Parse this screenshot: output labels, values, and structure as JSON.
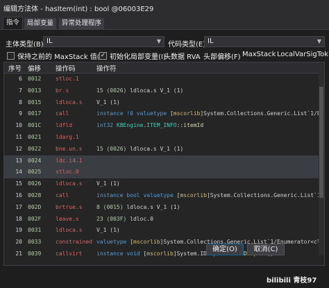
{
  "window": {
    "title": "编辑方法体 - hasItem(int) : bool @06003E29"
  },
  "tabs": [
    "指令",
    "局部变量",
    "异常处理程序"
  ],
  "header": {
    "body_type_label": "主体类型(B)",
    "body_type_value": "IL",
    "code_type_label": "代码类型(E)",
    "code_type_value": "IL"
  },
  "options": {
    "keep_maxstack": {
      "label": "保持之前的 MaxStack 值(K)",
      "checked": false
    },
    "init_locals": {
      "label": "初始化局部变量(I)",
      "checked": true
    },
    "header_rva": "头数据 RVA",
    "header_offset": "头部偏移(F)",
    "maxstack": "MaxStack",
    "localvarsig": "LocalVarSigTok"
  },
  "columns": [
    "序号",
    "偏移",
    "操作码",
    "操作符"
  ],
  "rows": [
    {
      "idx": "6",
      "off": "0012",
      "op": "stloc.1",
      "operand": []
    },
    {
      "idx": "7",
      "off": "0013",
      "op": "br.s",
      "operand": [
        [
          "num",
          "15 (0026) "
        ],
        [
          "plain",
          "ldloca.s V_1 (1)"
        ]
      ]
    },
    {
      "idx": "8",
      "off": "0015",
      "op": "ldloca.s",
      "operand": [
        [
          "plain",
          "V_1 (1)"
        ]
      ]
    },
    {
      "idx": "9",
      "off": "0017",
      "op": "call",
      "operand": [
        [
          "kw",
          "instance !0 "
        ],
        [
          "kw",
          "valuetype "
        ],
        [
          "plain",
          "["
        ],
        [
          "ns",
          "mscorlib"
        ],
        [
          "plain",
          "]System.Collections.Generic.List`1/Enumera"
        ]
      ]
    },
    {
      "idx": "10",
      "off": "001C",
      "op": "ldfld",
      "operand": [
        [
          "kw",
          "int32 "
        ],
        [
          "type",
          "KBEngine"
        ],
        [
          "plain",
          "."
        ],
        [
          "type",
          "ITEM_INFO"
        ],
        [
          "plain",
          "::"
        ],
        [
          "meth",
          "itemId"
        ]
      ]
    },
    {
      "idx": "11",
      "off": "0021",
      "op": "ldarg.1",
      "operand": []
    },
    {
      "idx": "12",
      "off": "0022",
      "op": "bne.un.s",
      "operand": [
        [
          "num",
          "15 (0026) "
        ],
        [
          "plain",
          "ldloca.s V_1 (1)"
        ]
      ]
    },
    {
      "idx": "13",
      "off": "0024",
      "op": "ldc.i4.1",
      "operand": [],
      "selected": true
    },
    {
      "idx": "14",
      "off": "0025",
      "op": "stloc.0",
      "operand": [],
      "selected": true
    },
    {
      "idx": "15",
      "off": "0026",
      "op": "ldloca.s",
      "operand": [
        [
          "plain",
          "V_1 (1)"
        ]
      ]
    },
    {
      "idx": "16",
      "off": "0028",
      "op": "call",
      "operand": [
        [
          "kw",
          "instance bool "
        ],
        [
          "kw",
          "valuetype "
        ],
        [
          "plain",
          "["
        ],
        [
          "ns",
          "mscorlib"
        ],
        [
          "plain",
          "]System.Collections.Generic.List`1/Enume"
        ]
      ]
    },
    {
      "idx": "17",
      "off": "002D",
      "op": "brtrue.s",
      "operand": [
        [
          "num",
          "8 (0015) "
        ],
        [
          "plain",
          "ldloca.s V_1 (1)"
        ]
      ]
    },
    {
      "idx": "18",
      "off": "002F",
      "op": "leave.s",
      "operand": [
        [
          "num",
          "23 (003F) "
        ],
        [
          "plain",
          "ldloc.0"
        ]
      ]
    },
    {
      "idx": "19",
      "off": "0031",
      "op": "ldloca.s",
      "operand": [
        [
          "plain",
          "V_1 (1)"
        ]
      ]
    },
    {
      "idx": "20",
      "off": "0033",
      "op": "constrained",
      "operand": [
        [
          "kw",
          "valuetype "
        ],
        [
          "plain",
          "["
        ],
        [
          "ns",
          "mscorlib"
        ],
        [
          "plain",
          "]System.Collections.Generic.List`1/Enumerator<class KB"
        ]
      ]
    },
    {
      "idx": "21",
      "off": "0039",
      "op": "callvirt",
      "operand": [
        [
          "kw",
          "instance void "
        ],
        [
          "plain",
          "["
        ],
        [
          "ns",
          "mscorlib"
        ],
        [
          "plain",
          "]System.IDisposable::"
        ],
        [
          "meth",
          "Dispose"
        ],
        [
          "plain",
          "()"
        ]
      ]
    }
  ],
  "buttons": {
    "ok": "确定(O)",
    "cancel": "取消(C)"
  },
  "watermark": "bilibili 青枝97"
}
